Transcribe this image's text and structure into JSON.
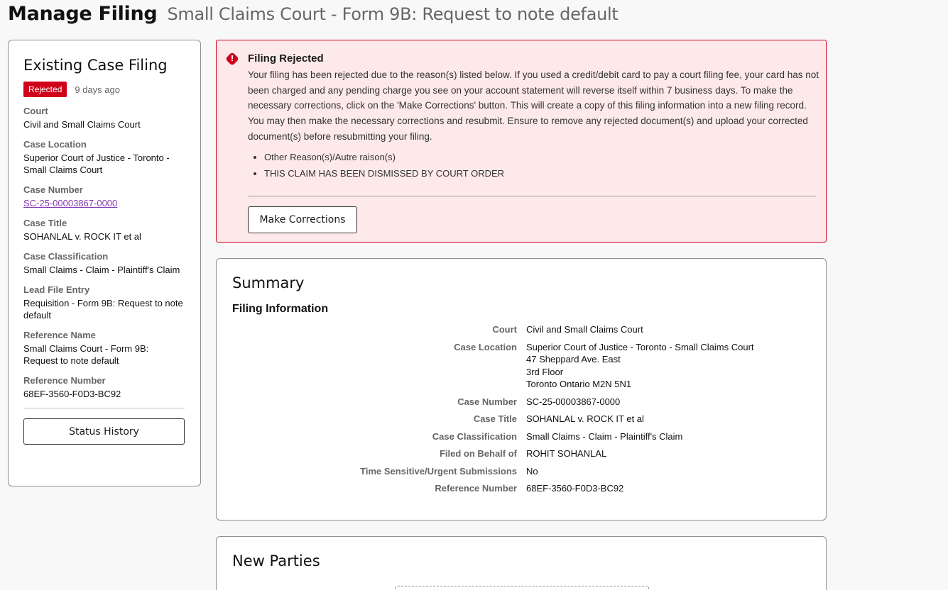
{
  "header": {
    "title": "Manage Filing",
    "subtitle": "Small Claims Court - Form 9B: Request to note default"
  },
  "existing": {
    "title": "Existing Case Filing",
    "status": "Rejected",
    "age": "9 days ago",
    "fields": [
      {
        "label": "Court",
        "value": "Civil and Small Claims Court"
      },
      {
        "label": "Case Location",
        "value": "Superior Court of Justice - Toronto - Small Claims Court"
      },
      {
        "label": "Case Number",
        "value": "SC-25-00003867-0000"
      },
      {
        "label": "Case Title",
        "value": "SOHANLAL v. ROCK IT et al"
      },
      {
        "label": "Case Classification",
        "value": "Small Claims - Claim - Plaintiff's Claim"
      },
      {
        "label": "Lead File Entry",
        "value": "Requisition - Form 9B: Request to note default"
      },
      {
        "label": "Reference Name",
        "value": "Small Claims Court - Form 9B: Request to note default"
      },
      {
        "label": "Reference Number",
        "value": "68EF-3560-F0D3-BC92"
      }
    ],
    "status_history_label": "Status History"
  },
  "alert": {
    "icon": "exclamation-icon",
    "title": "Filing Rejected",
    "text": "Your filing has been rejected due to the reason(s) listed below. If you used a credit/debit card to pay a court filing fee, your card has not been charged and any pending charge you see on your account statement will reverse itself within 7 business days. To make the necessary corrections, click on the 'Make Corrections' button. This will create a copy of this filing information into a new filing record. You may then make the necessary corrections and resubmit. Ensure to remove any rejected document(s) and upload your corrected document(s) before resubmitting your filing.",
    "reasons": [
      "Other Reason(s)/Autre raison(s)",
      "THIS CLAIM HAS BEEN DISMISSED BY COURT ORDER"
    ],
    "button_label": "Make Corrections",
    "color": "#d0021b",
    "background": "#fde9ea"
  },
  "summary": {
    "title": "Summary",
    "section": "Filing Information",
    "rows": [
      {
        "key": "Court",
        "lines": [
          "Civil and Small Claims Court"
        ]
      },
      {
        "key": "Case Location",
        "lines": [
          "Superior Court of Justice - Toronto - Small Claims Court",
          "47 Sheppard Ave. East",
          "3rd Floor",
          "Toronto Ontario M2N 5N1"
        ]
      },
      {
        "key": "Case Number",
        "lines": [
          "SC-25-00003867-0000"
        ]
      },
      {
        "key": "Case Title",
        "lines": [
          "SOHANLAL v. ROCK IT et al"
        ]
      },
      {
        "key": "Case Classification",
        "lines": [
          "Small Claims - Claim - Plaintiff's Claim"
        ]
      },
      {
        "key": "Filed on Behalf of",
        "lines": [
          "ROHIT SOHANLAL"
        ]
      },
      {
        "key": "Time Sensitive/Urgent Submissions",
        "lines": [
          "No"
        ]
      },
      {
        "key": "Reference Number",
        "lines": [
          "68EF-3560-F0D3-BC92"
        ]
      }
    ]
  },
  "parties": {
    "title": "New Parties"
  }
}
